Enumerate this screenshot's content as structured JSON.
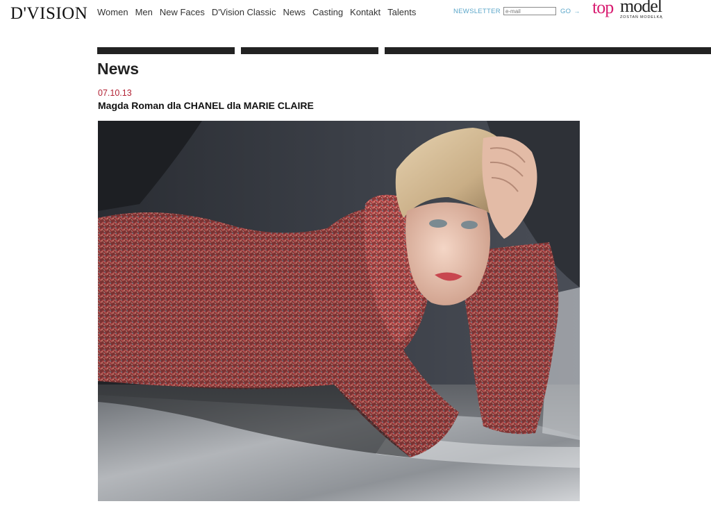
{
  "header": {
    "logo": "D'VISION",
    "nav": [
      "Women",
      "Men",
      "New Faces",
      "D'Vision Classic",
      "News",
      "Casting",
      "Kontakt",
      "Talents"
    ],
    "newsletter": {
      "label": "NEWSLETTER",
      "placeholder": "e-mail",
      "go_label": "GO",
      "arrow": "→"
    },
    "brand": {
      "top": "top",
      "model": "model",
      "tagline": "ZOSTAŃ MODELKĄ"
    }
  },
  "main": {
    "section_title": "News",
    "article": {
      "date": "07.10.13",
      "headline": "Magda Roman dla CHANEL dla MARIE CLAIRE"
    }
  },
  "colors": {
    "date": "#b22234",
    "newsletter": "#5aa6c9",
    "brand_accent": "#d81b70",
    "bars": "#222222"
  }
}
